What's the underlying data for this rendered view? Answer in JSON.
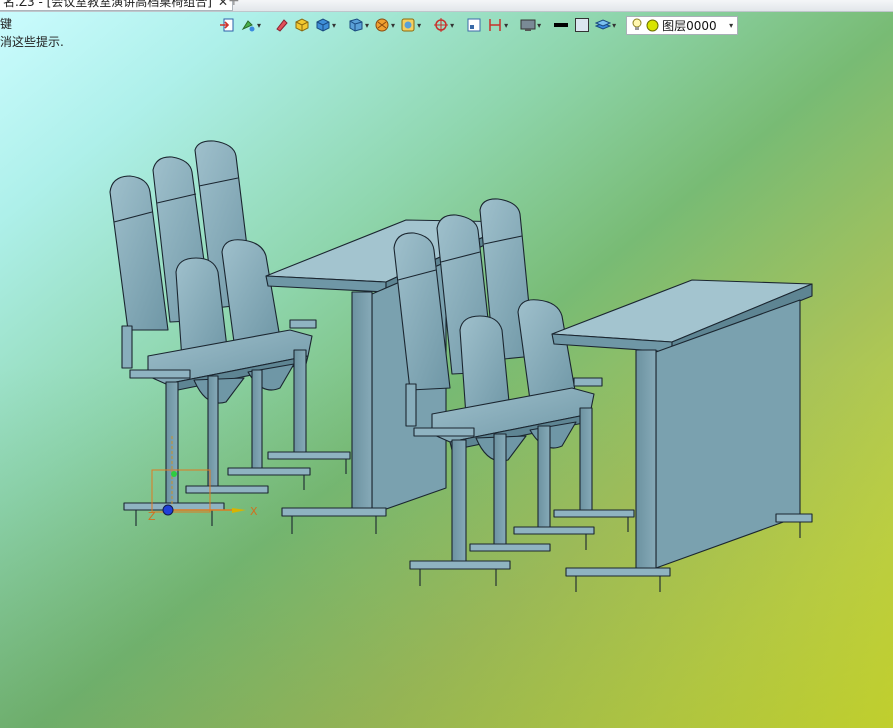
{
  "title_tab": {
    "text": "名.Z3 - [会议室教室演讲高档桌椅组合]",
    "close": "✕",
    "new_tab": "+"
  },
  "hints": {
    "line1": "键",
    "line2": "消这些提示."
  },
  "toolbar": {
    "icons": [
      "import-icon",
      "paint-icon",
      "eraser-icon",
      "box-icon",
      "cube-icon",
      "view-cube-icon",
      "render-icon",
      "frame-icon",
      "target-icon",
      "window-icon",
      "dimension-icon",
      "display-icon",
      "line-color-icon",
      "fill-color-icon",
      "layers-icon"
    ],
    "dropdown_arrow": "▾"
  },
  "layer": {
    "label": "图层0000",
    "arrow": "▾",
    "bulb_color": "#e8e000",
    "dot_color": "#d8e400"
  },
  "colors": {
    "model_fill": "#7fa8b6",
    "model_dark": "#5e8593",
    "model_light": "#a3c4cf",
    "edge": "#1b2630"
  }
}
